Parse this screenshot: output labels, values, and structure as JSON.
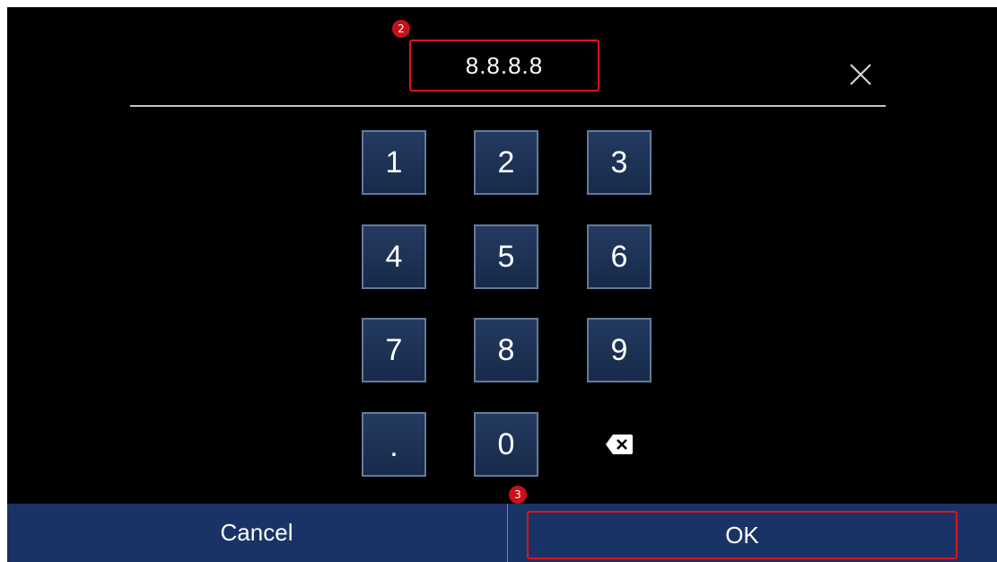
{
  "entry": {
    "value": "8.8.8.8",
    "step_marker": "2"
  },
  "keypad": {
    "keys": [
      "1",
      "2",
      "3",
      "4",
      "5",
      "6",
      "7",
      "8",
      "9",
      ".",
      "0"
    ]
  },
  "icons": {
    "close": "close-icon",
    "backspace": "backspace-icon"
  },
  "footer": {
    "cancel_label": "Cancel",
    "ok_label": "OK",
    "ok_step_marker": "3"
  },
  "colors": {
    "background": "#000000",
    "key_fill": "#1e3458",
    "key_border": "#66799a",
    "bar_fill": "#1a3366",
    "highlight": "#e0121b"
  }
}
